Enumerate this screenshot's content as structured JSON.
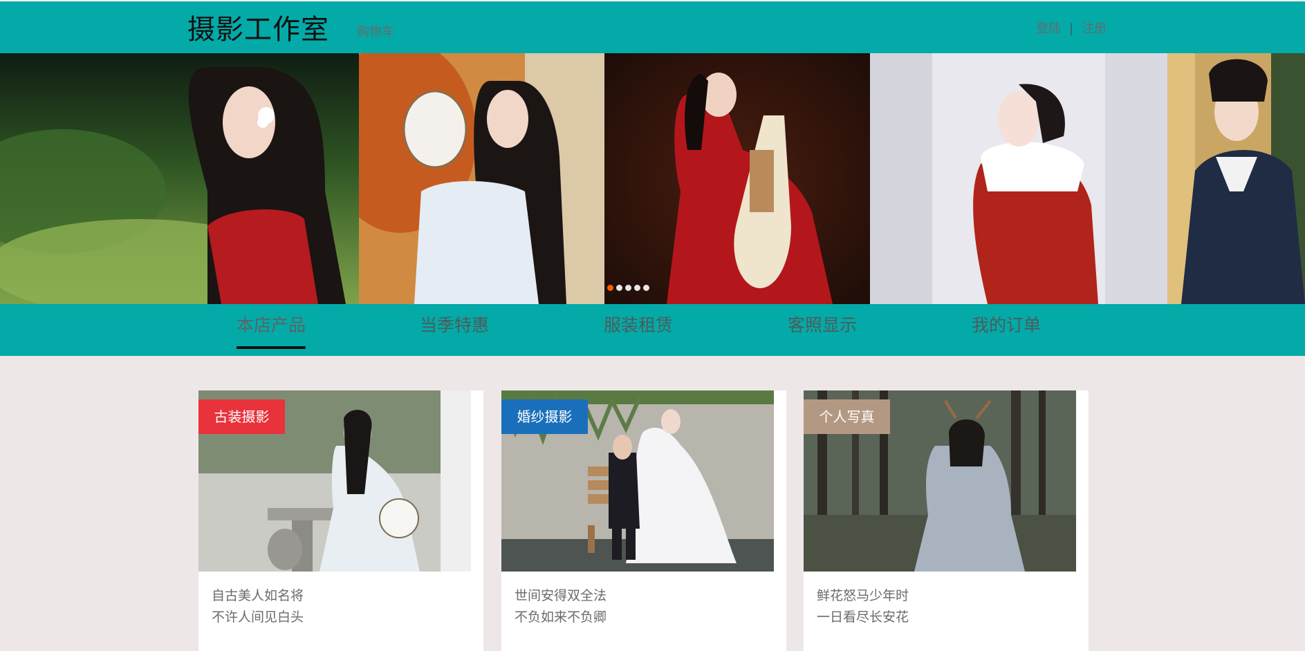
{
  "header": {
    "brand": "摄影工作室",
    "cart": "购物车",
    "login": "登陆",
    "separator": "|",
    "register": "注册"
  },
  "banner": {
    "slides": [
      "slide-1",
      "slide-2",
      "slide-3",
      "slide-4",
      "slide-5"
    ],
    "dots_count": 5,
    "active_dot": 1
  },
  "categories": {
    "items": [
      "本店产品",
      "当季特惠",
      "服装租赁",
      "客照显示",
      "我的订单"
    ],
    "active": "本店产品"
  },
  "cards": [
    {
      "tag": "古装摄影",
      "tag_color": "#e8323c",
      "line1": "自古美人如名将",
      "line2": "不许人间见白头"
    },
    {
      "tag": "婚纱摄影",
      "tag_color": "#1a6fba",
      "line1": "世间安得双全法",
      "line2": "不负如来不负卿"
    },
    {
      "tag": "个人写真",
      "tag_color": "#b39983",
      "line1": "鲜花怒马少年时",
      "line2": "一日看尽长安花"
    }
  ],
  "colors": {
    "primary": "#03aaa8",
    "page_bg": "#ede8e7"
  }
}
